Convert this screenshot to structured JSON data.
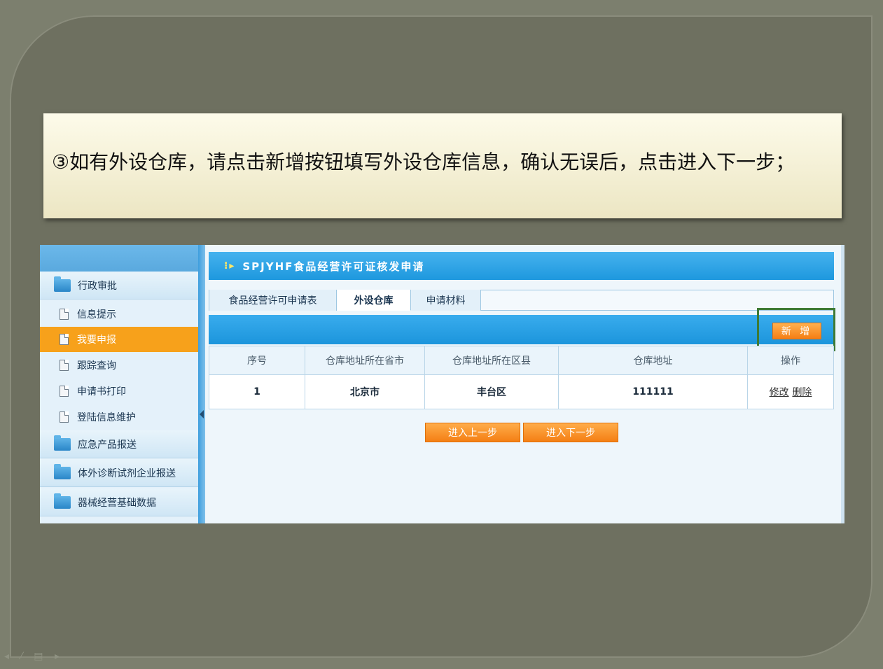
{
  "instruction": "③如有外设仓库，请点击新增按钮填写外设仓库信息，确认无误后，点击进入下一步；",
  "sidebar": {
    "items": [
      {
        "label": "行政审批",
        "type": "folder",
        "icon": "folder-icon"
      },
      {
        "label": "信息提示",
        "type": "page",
        "icon": "document-icon"
      },
      {
        "label": "我要申报",
        "type": "page",
        "icon": "document-icon",
        "active": true
      },
      {
        "label": "跟踪查询",
        "type": "page",
        "icon": "document-icon"
      },
      {
        "label": "申请书打印",
        "type": "page",
        "icon": "document-icon"
      },
      {
        "label": "登陆信息维护",
        "type": "page",
        "icon": "document-icon"
      },
      {
        "label": "应急产品报送",
        "type": "folder",
        "icon": "folder-icon"
      },
      {
        "label": "体外诊断试剂企业报送",
        "type": "folder",
        "icon": "folder-icon"
      },
      {
        "label": "器械经营基础数据",
        "type": "folder",
        "icon": "folder-icon"
      }
    ]
  },
  "main": {
    "title": "SPJYHF食品经营许可证核发申请",
    "tabs": [
      {
        "label": "食品经营许可申请表",
        "active": false
      },
      {
        "label": "外设仓库",
        "active": true
      },
      {
        "label": "申请材料",
        "active": false
      }
    ],
    "add_button": "新 增",
    "table": {
      "headers": [
        "序号",
        "仓库地址所在省市",
        "仓库地址所在区县",
        "仓库地址",
        "操作"
      ],
      "rows": [
        {
          "index": "1",
          "province": "北京市",
          "district": "丰台区",
          "address": "111111",
          "edit": "修改",
          "delete": "删除"
        }
      ]
    },
    "prev_button": "进入上一步",
    "next_button": "进入下一步"
  },
  "colors": {
    "slide_background": "#6e7060",
    "accent_orange": "#f7a11b",
    "header_blue": "#1e98de",
    "highlight_green": "#3e7a35"
  }
}
